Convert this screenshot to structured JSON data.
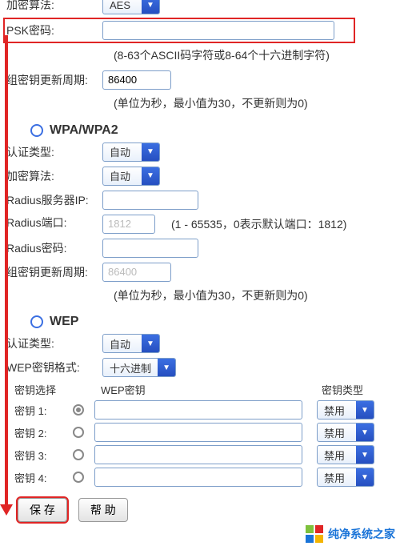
{
  "psk_section": {
    "encrypt_algo_label": "加密算法:",
    "encrypt_algo_value": "AES",
    "psk_password_label": "PSK密码:",
    "psk_password_value": "",
    "psk_hint": "(8-63个ASCII码字符或8-64个十六进制字符)",
    "group_key_label": "组密钥更新周期:",
    "group_key_value": "86400",
    "group_key_hint": "(单位为秒，最小值为30，不更新则为0)"
  },
  "wpa_section": {
    "title": "WPA/WPA2",
    "auth_type_label": "认证类型:",
    "auth_type_value": "自动",
    "encrypt_algo_label": "加密算法:",
    "encrypt_algo_value": "自动",
    "radius_ip_label": "Radius服务器IP:",
    "radius_ip_value": "",
    "radius_port_label": "Radius端口:",
    "radius_port_value": "1812",
    "radius_port_hint": "(1 - 65535，0表示默认端口：1812)",
    "radius_pwd_label": "Radius密码:",
    "radius_pwd_value": "",
    "group_key_label": "组密钥更新周期:",
    "group_key_value": "86400",
    "group_key_hint": "(单位为秒，最小值为30，不更新则为0)"
  },
  "wep_section": {
    "title": "WEP",
    "auth_type_label": "认证类型:",
    "auth_type_value": "自动",
    "key_format_label": "WEP密钥格式:",
    "key_format_value": "十六进制",
    "header_select": "密钥选择",
    "header_key": "WEP密钥",
    "header_type": "密钥类型",
    "keys": [
      {
        "label": "密钥 1:",
        "selected": true,
        "value": "",
        "type": "禁用"
      },
      {
        "label": "密钥 2:",
        "selected": false,
        "value": "",
        "type": "禁用"
      },
      {
        "label": "密钥 3:",
        "selected": false,
        "value": "",
        "type": "禁用"
      },
      {
        "label": "密钥 4:",
        "selected": false,
        "value": "",
        "type": "禁用"
      }
    ]
  },
  "buttons": {
    "save": "保 存",
    "help": "帮 助"
  },
  "watermark_text": "纯净系统之家"
}
